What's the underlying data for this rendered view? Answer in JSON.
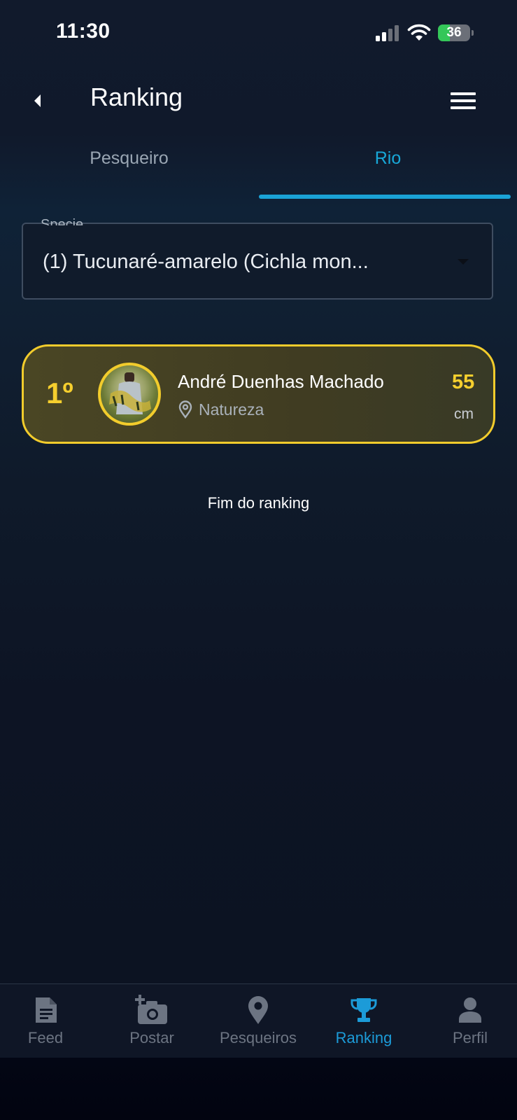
{
  "status_bar": {
    "time": "11:30",
    "battery": "36",
    "battery_level": 0.36
  },
  "header": {
    "title": "Ranking"
  },
  "tabs": [
    {
      "label": "Pesqueiro",
      "active": false
    },
    {
      "label": "Rio",
      "active": true
    }
  ],
  "species_select": {
    "label": "Specie",
    "value": "(1) Tucunaré-amarelo (Cichla mon..."
  },
  "ranking": [
    {
      "position": "1º",
      "name": "André Duenhas Machado",
      "location": "Natureza",
      "size": "55",
      "unit": "cm"
    }
  ],
  "end_text": "Fim do ranking",
  "bottom_nav": [
    {
      "label": "Feed",
      "icon": "document-icon",
      "active": false
    },
    {
      "label": "Postar",
      "icon": "camera-add-icon",
      "active": false
    },
    {
      "label": "Pesqueiros",
      "icon": "map-pin-icon",
      "active": false
    },
    {
      "label": "Ranking",
      "icon": "trophy-icon",
      "active": true
    },
    {
      "label": "Perfil",
      "icon": "person-icon",
      "active": false
    }
  ],
  "colors": {
    "accent": "#1aa3d6",
    "gold": "#f6cf2e",
    "background": "#0d1424"
  }
}
